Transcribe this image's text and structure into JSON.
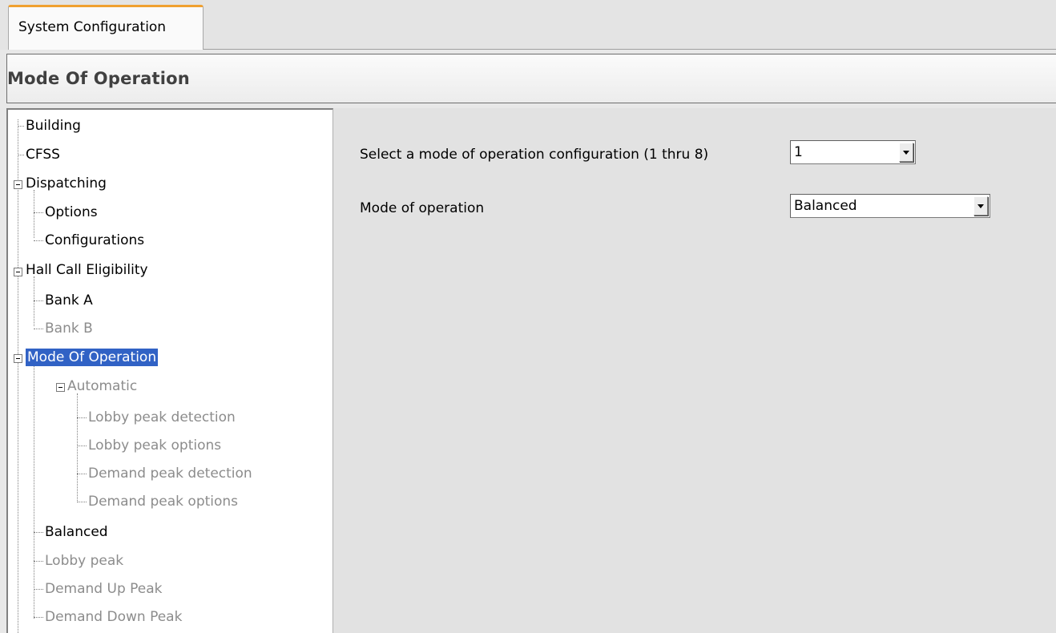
{
  "tab": {
    "label": "System Configuration"
  },
  "header": {
    "title": "Mode Of Operation"
  },
  "tree": {
    "building": "Building",
    "cfss": "CFSS",
    "dispatching": "Dispatching",
    "options": "Options",
    "configurations": "Configurations",
    "hall_call_eligibility": "Hall Call Eligibility",
    "bank_a": "Bank A",
    "bank_b": "Bank B",
    "mode_of_operation": "Mode Of Operation",
    "automatic": "Automatic",
    "lobby_peak_detection": "Lobby peak detection",
    "lobby_peak_options": "Lobby peak options",
    "demand_peak_detection": "Demand peak detection",
    "demand_peak_options": "Demand peak options",
    "balanced": "Balanced",
    "lobby_peak": "Lobby peak",
    "demand_up_peak": "Demand Up Peak",
    "demand_down_peak": "Demand Down Peak"
  },
  "form": {
    "config_label": "Select a mode of operation configuration (1 thru 8)",
    "config_value": "1",
    "mode_label": "Mode of operation",
    "mode_value": "Balanced"
  }
}
